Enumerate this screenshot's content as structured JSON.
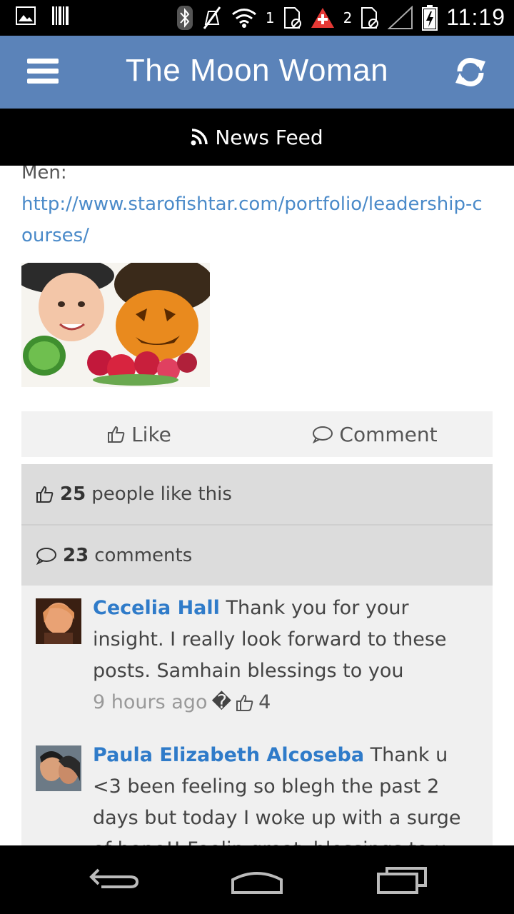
{
  "status_bar": {
    "sim1": "1",
    "sim2": "2",
    "time": "11:19"
  },
  "header": {
    "title": "The Moon Woman"
  },
  "feed_bar": {
    "label": "News Feed"
  },
  "post": {
    "text_prefix": "Men:",
    "link": "http://www.starofishtar.com/portfolio/leadership-courses/"
  },
  "actions": {
    "like_label": "Like",
    "comment_label": "Comment"
  },
  "stats": {
    "likes_count": "25",
    "likes_text": "people like this",
    "comments_count": "23",
    "comments_text": "comments"
  },
  "comments": [
    {
      "author": "Cecelia Hall",
      "text": "Thank you for your insight. I really look forward to these posts. Samhain blessings to you",
      "time": "9 hours ago",
      "separator": "�",
      "likes": "4"
    },
    {
      "author": "Paula Elizabeth Alcoseba",
      "text": "Thank u <3 been feeling so blegh the past 2 days but today I woke up with a surge of hope!! Feelin great, blessings to u"
    }
  ],
  "colors": {
    "header_bg": "#5b83b9",
    "link": "#4a8ac9",
    "author": "#2f7bc9"
  }
}
